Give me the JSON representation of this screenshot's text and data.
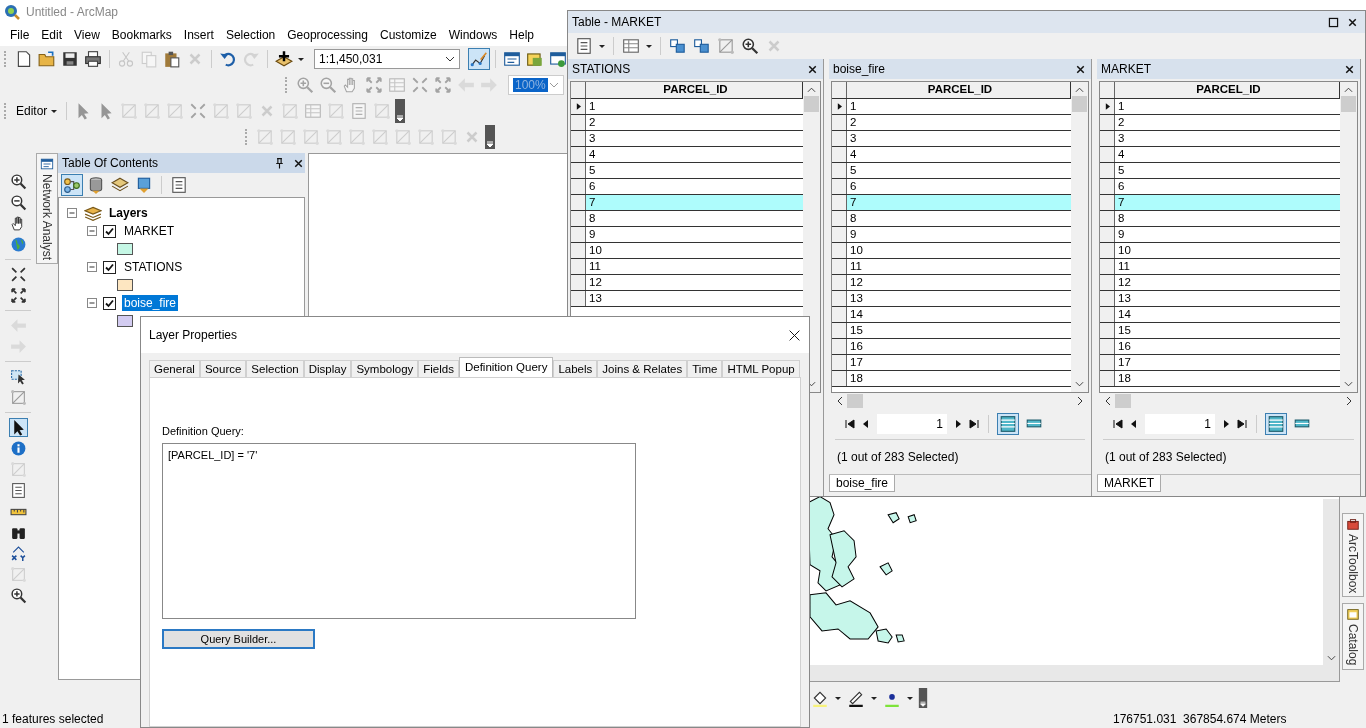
{
  "window": {
    "title": "Untitled - ArcMap"
  },
  "menu": [
    "File",
    "Edit",
    "View",
    "Bookmarks",
    "Insert",
    "Selection",
    "Geoprocessing",
    "Customize",
    "Windows",
    "Help"
  ],
  "toolbar": {
    "scale": "1:1,450,031",
    "zoom": "100%",
    "editor": "Editor"
  },
  "left_tabs": [
    "Network Analyst"
  ],
  "toc": {
    "title": "Table Of Contents",
    "root": {
      "label": "Layers",
      "expanded": true,
      "children": [
        {
          "name": "MARKET",
          "checked": true,
          "expanded": true,
          "selected": false,
          "color": "#c5f7e5"
        },
        {
          "name": "STATIONS",
          "checked": true,
          "expanded": true,
          "selected": false,
          "color": "#fde6c1"
        },
        {
          "name": "boise_fire",
          "checked": true,
          "expanded": true,
          "selected": true,
          "color": "#d3ccf1"
        }
      ]
    }
  },
  "right_tabs": [
    "ArcToolbox",
    "Catalog"
  ],
  "table_window": {
    "title": "Table - MARKET",
    "panes": [
      {
        "name": "STATIONS",
        "column": "PARCEL_ID",
        "rows": [
          {
            "value": "1",
            "current": true,
            "selected": false
          },
          {
            "value": "2",
            "current": false,
            "selected": false
          },
          {
            "value": "3",
            "current": false,
            "selected": false
          },
          {
            "value": "4",
            "current": false,
            "selected": false
          },
          {
            "value": "5",
            "current": false,
            "selected": false
          },
          {
            "value": "6",
            "current": false,
            "selected": false
          },
          {
            "value": "7",
            "current": false,
            "selected": true
          },
          {
            "value": "8",
            "current": false,
            "selected": false
          },
          {
            "value": "9",
            "current": false,
            "selected": false
          },
          {
            "value": "10",
            "current": false,
            "selected": false
          },
          {
            "value": "11",
            "current": false,
            "selected": false
          },
          {
            "value": "12",
            "current": false,
            "selected": false
          },
          {
            "value": "13",
            "current": false,
            "selected": false
          }
        ]
      },
      {
        "name": "boise_fire",
        "column": "PARCEL_ID",
        "page": "1",
        "status": "(1 out of 283 Selected)",
        "tab": "boise_fire",
        "rows": [
          {
            "value": "1",
            "current": true,
            "selected": false
          },
          {
            "value": "2",
            "current": false,
            "selected": false
          },
          {
            "value": "3",
            "current": false,
            "selected": false
          },
          {
            "value": "4",
            "current": false,
            "selected": false
          },
          {
            "value": "5",
            "current": false,
            "selected": false
          },
          {
            "value": "6",
            "current": false,
            "selected": false
          },
          {
            "value": "7",
            "current": false,
            "selected": true
          },
          {
            "value": "8",
            "current": false,
            "selected": false
          },
          {
            "value": "9",
            "current": false,
            "selected": false
          },
          {
            "value": "10",
            "current": false,
            "selected": false
          },
          {
            "value": "11",
            "current": false,
            "selected": false
          },
          {
            "value": "12",
            "current": false,
            "selected": false
          },
          {
            "value": "13",
            "current": false,
            "selected": false
          },
          {
            "value": "14",
            "current": false,
            "selected": false
          },
          {
            "value": "15",
            "current": false,
            "selected": false
          },
          {
            "value": "16",
            "current": false,
            "selected": false
          },
          {
            "value": "17",
            "current": false,
            "selected": false
          },
          {
            "value": "18",
            "current": false,
            "selected": false
          }
        ]
      },
      {
        "name": "MARKET",
        "column": "PARCEL_ID",
        "page": "1",
        "status": "(1 out of 283 Selected)",
        "tab": "MARKET",
        "rows": [
          {
            "value": "1",
            "current": true,
            "selected": false
          },
          {
            "value": "2",
            "current": false,
            "selected": false
          },
          {
            "value": "3",
            "current": false,
            "selected": false
          },
          {
            "value": "4",
            "current": false,
            "selected": false
          },
          {
            "value": "5",
            "current": false,
            "selected": false
          },
          {
            "value": "6",
            "current": false,
            "selected": false
          },
          {
            "value": "7",
            "current": false,
            "selected": true
          },
          {
            "value": "8",
            "current": false,
            "selected": false
          },
          {
            "value": "9",
            "current": false,
            "selected": false
          },
          {
            "value": "10",
            "current": false,
            "selected": false
          },
          {
            "value": "11",
            "current": false,
            "selected": false
          },
          {
            "value": "12",
            "current": false,
            "selected": false
          },
          {
            "value": "13",
            "current": false,
            "selected": false
          },
          {
            "value": "14",
            "current": false,
            "selected": false
          },
          {
            "value": "15",
            "current": false,
            "selected": false
          },
          {
            "value": "16",
            "current": false,
            "selected": false
          },
          {
            "value": "17",
            "current": false,
            "selected": false
          },
          {
            "value": "18",
            "current": false,
            "selected": false
          }
        ]
      }
    ]
  },
  "dialog": {
    "title": "Layer Properties",
    "tabs": [
      {
        "label": "General",
        "selected": false
      },
      {
        "label": "Source",
        "selected": false
      },
      {
        "label": "Selection",
        "selected": false
      },
      {
        "label": "Display",
        "selected": false
      },
      {
        "label": "Symbology",
        "selected": false
      },
      {
        "label": "Fields",
        "selected": false
      },
      {
        "label": "Definition Query",
        "selected": true
      },
      {
        "label": "Labels",
        "selected": false
      },
      {
        "label": "Joins & Relates",
        "selected": false
      },
      {
        "label": "Time",
        "selected": false
      },
      {
        "label": "HTML Popup",
        "selected": false
      }
    ],
    "query_label": "Definition Query:",
    "query": "[PARCEL_ID] = '7'",
    "button": "Query Builder..."
  },
  "status_bar": {
    "message": "1 features selected",
    "coordinates": "176751.031  367854.674 Meters"
  }
}
